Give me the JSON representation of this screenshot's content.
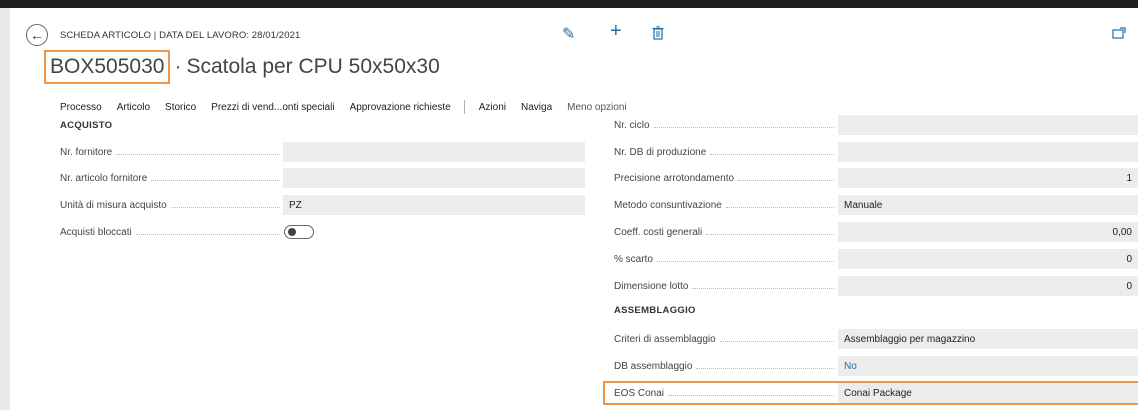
{
  "header": {
    "caption": "SCHEDA ARTICOLO | DATA DEL LAVORO: 28/01/2021",
    "item_code": "BOX505030",
    "separator": "·",
    "item_description": "Scatola per CPU 50x50x30"
  },
  "icons": {
    "back": "back-arrow-icon",
    "edit": "pencil-icon",
    "new": "plus-icon",
    "delete": "trash-icon",
    "popout": "open-in-new-window-icon"
  },
  "menu": {
    "items": [
      "Processo",
      "Articolo",
      "Storico",
      "Prezzi di vend...onti speciali",
      "Approvazione richieste"
    ],
    "actions": [
      "Azioni",
      "Naviga"
    ],
    "less_options": "Meno opzioni"
  },
  "left": {
    "section_title": "ACQUISTO",
    "fields": [
      {
        "label": "Nr. fornitore",
        "value": ""
      },
      {
        "label": "Nr. articolo fornitore",
        "value": ""
      },
      {
        "label": "Unità di misura acquisto",
        "value": "PZ"
      },
      {
        "label": "Acquisti bloccati",
        "toggle_on": false
      }
    ]
  },
  "right": {
    "fields": [
      {
        "label": "Nr. ciclo",
        "value": ""
      },
      {
        "label": "Nr. DB di produzione",
        "value": ""
      },
      {
        "label": "Precisione arrotondamento",
        "value": "1"
      },
      {
        "label": "Metodo consuntivazione",
        "value": "Manuale"
      },
      {
        "label": "Coeff. costi generali",
        "value": "0,00"
      },
      {
        "label": "% scarto",
        "value": "0"
      },
      {
        "label": "Dimensione lotto",
        "value": "0"
      }
    ],
    "section2_title": "ASSEMBLAGGIO",
    "assembly_fields": [
      {
        "label": "Criteri di assemblaggio",
        "value": "Assemblaggio per magazzino"
      },
      {
        "label": "DB assemblaggio",
        "value": "No"
      },
      {
        "label": "EOS Conai",
        "value": "Conai Package"
      }
    ]
  },
  "colors": {
    "accent": "#1f6fa8",
    "highlight": "#f0954a",
    "field_background": "#ececec"
  }
}
